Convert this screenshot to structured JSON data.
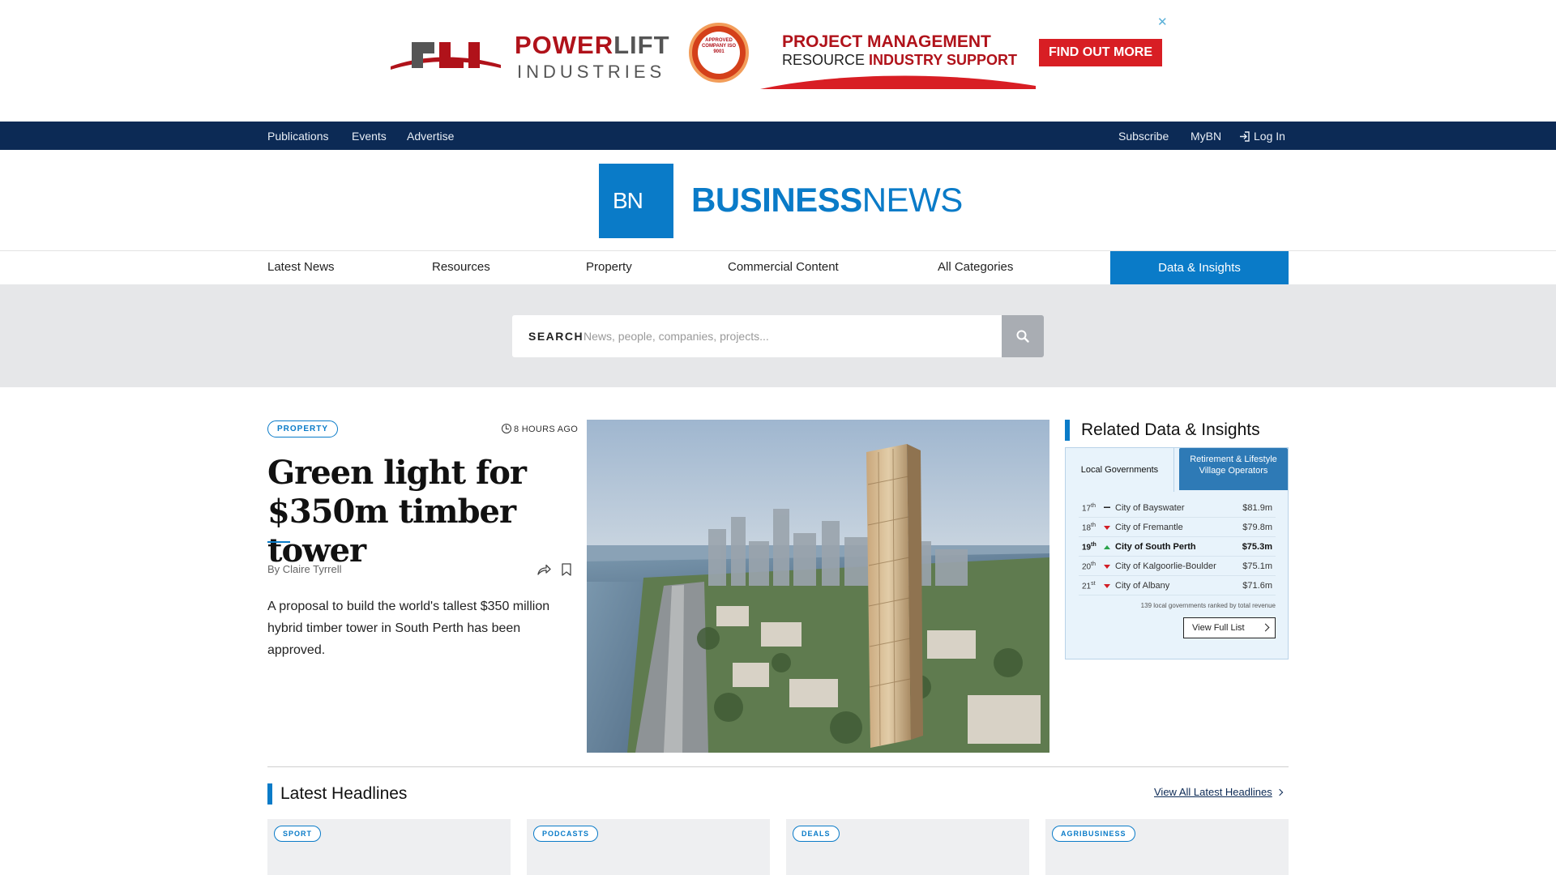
{
  "ad": {
    "brand_top_red": "POWER",
    "brand_top_grey": "LIFT",
    "brand_bottom": "INDUSTRIES",
    "logo_letters": "PLI",
    "badge_text": "APPROVED COMPANY ISO 9001",
    "headline_line1": "PROJECT MANAGEMENT",
    "headline_line2_a": "RESOURCE ",
    "headline_line2_b": "INDUSTRY SUPPORT",
    "cta": "FIND OUT MORE",
    "close": "✕",
    "colors": {
      "red": "#d81e24",
      "dark_red": "#b0121a"
    }
  },
  "topbar": {
    "left_links": [
      "Publications",
      "Events",
      "Advertise"
    ],
    "right_links": [
      "Subscribe",
      "MyBN"
    ],
    "login": "Log In",
    "background": "#0c2a55"
  },
  "logo": {
    "mark": "BN",
    "word_bold": "BUSINESS",
    "word_light": "NEWS",
    "brand_color": "#0a7bc8"
  },
  "mainnav": {
    "items": [
      "Latest News",
      "Resources",
      "Property",
      "Commercial Content",
      "All Categories"
    ],
    "active": "Data & Insights"
  },
  "search": {
    "label": "SEARCH",
    "placeholder": "News, people, companies, projects..."
  },
  "feature": {
    "category": "PROPERTY",
    "time": "8 HOURS AGO",
    "headline": "Green light for $350m timber tower",
    "byline": "By Claire Tyrrell",
    "summary": "A proposal to build the world's tallest $350 million hybrid timber tower in South Perth has been approved."
  },
  "related": {
    "title": "Related Data & Insights",
    "tabs": [
      "Local Governments",
      "Retirement & Lifestyle Village Operators"
    ],
    "rows": [
      {
        "rank": "17",
        "suffix": "th",
        "trend": "same",
        "name": "City of Bayswater",
        "value": "$81.9m"
      },
      {
        "rank": "18",
        "suffix": "th",
        "trend": "down",
        "name": "City of Fremantle",
        "value": "$79.8m"
      },
      {
        "rank": "19",
        "suffix": "th",
        "trend": "up",
        "name": "City of South Perth",
        "value": "$75.3m"
      },
      {
        "rank": "20",
        "suffix": "th",
        "trend": "down",
        "name": "City of Kalgoorlie-Boulder",
        "value": "$75.1m"
      },
      {
        "rank": "21",
        "suffix": "st",
        "trend": "down",
        "name": "City of Albany",
        "value": "$71.6m"
      }
    ],
    "note": "139 local governments ranked by total revenue",
    "button": "View Full List"
  },
  "headlines": {
    "title": "Latest Headlines",
    "link": "View All Latest Headlines",
    "cards": [
      "SPORT",
      "PODCASTS",
      "DEALS",
      "AGRIBUSINESS"
    ]
  }
}
